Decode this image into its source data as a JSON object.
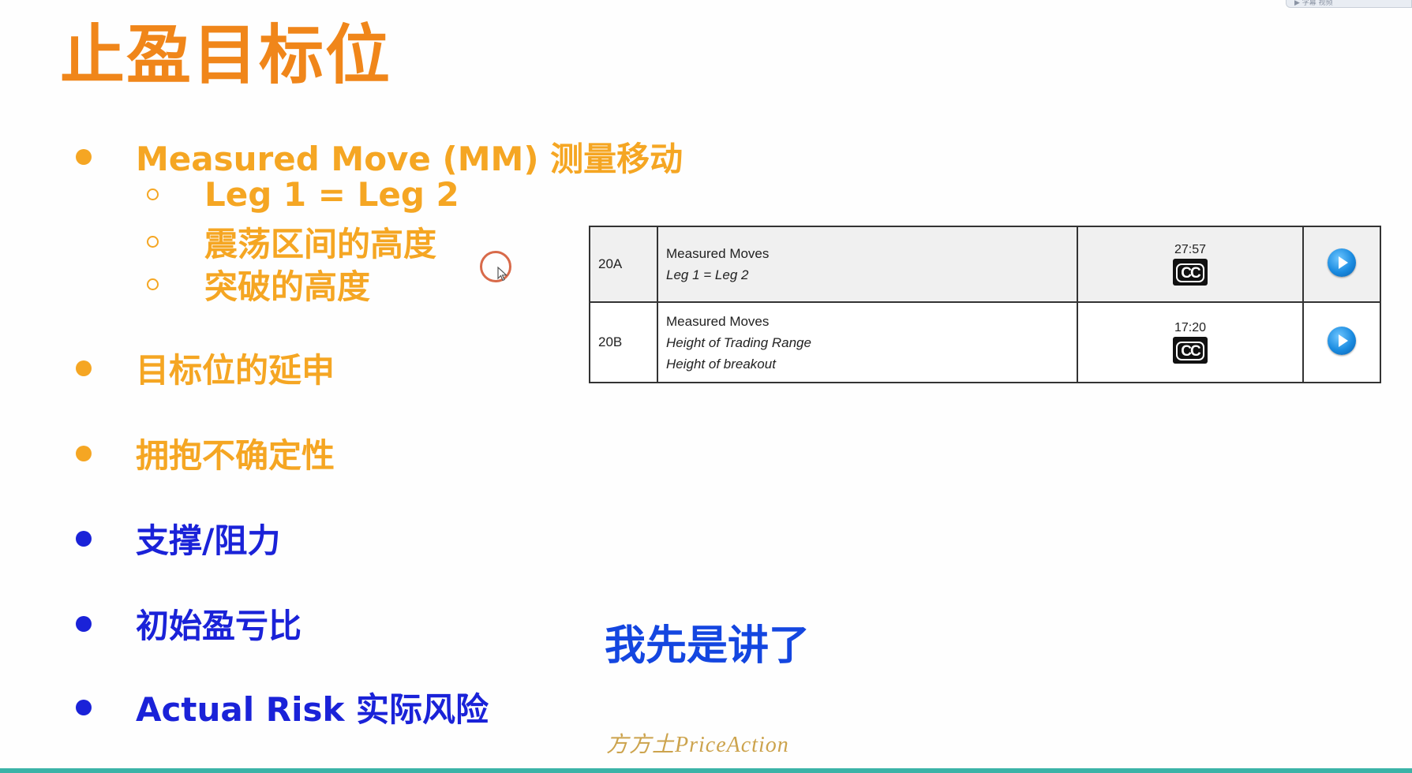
{
  "colors": {
    "orange": "#f0861a",
    "orange_light": "#f5a623",
    "blue": "#1a22d8",
    "caption_blue": "#1446e0"
  },
  "title": "止盈目标位",
  "bullets": [
    {
      "text": "Measured Move (MM) 测量移动",
      "color": "orange"
    },
    {
      "text": "目标位的延申",
      "color": "orange"
    },
    {
      "text": "拥抱不确定性",
      "color": "orange"
    },
    {
      "text": "支撑/阻力",
      "color": "blue"
    },
    {
      "text": "初始盈亏比",
      "color": "blue"
    },
    {
      "text": "Actual Risk 实际风险",
      "color": "blue"
    }
  ],
  "sub_bullets": [
    "Leg 1 = Leg 2",
    "震荡区间的高度",
    "突破的高度"
  ],
  "table": {
    "rows": [
      {
        "id": "20A",
        "title": "Measured Moves",
        "lines": [
          "Leg 1 = Leg 2"
        ],
        "time": "27:57",
        "cc": "CC",
        "play_icon": "play-icon"
      },
      {
        "id": "20B",
        "title": "Measured Moves",
        "lines": [
          "Height of Trading Range",
          "Height of breakout"
        ],
        "time": "17:20",
        "cc": "CC",
        "play_icon": "play-icon"
      }
    ]
  },
  "caption": "我先是讲了",
  "watermark": "方方土PriceAction",
  "top_widget_text": "▶ 字幕 视频"
}
